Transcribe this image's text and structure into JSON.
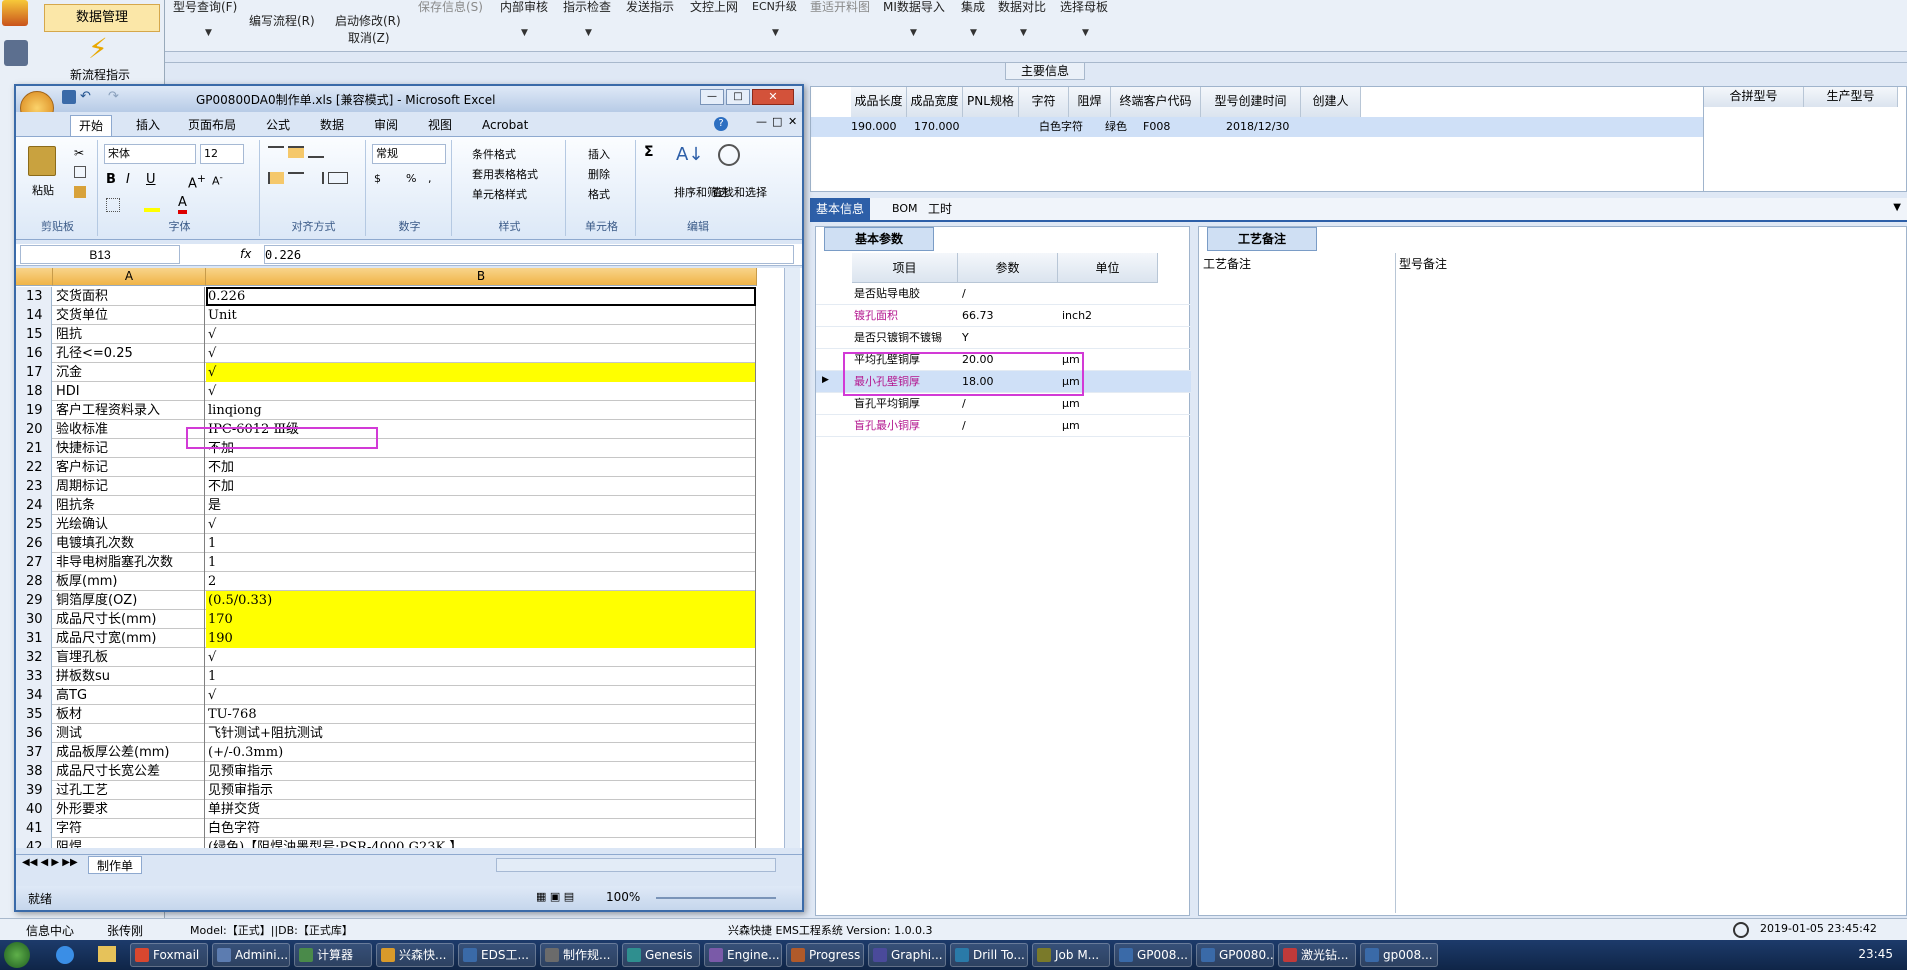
{
  "app": {
    "left_items": [
      "数据管理",
      "新流程指示"
    ],
    "toolbar": [
      {
        "label": "型号查询(F)",
        "disabled": false
      },
      {
        "label": "编写流程(R)",
        "disabled": false
      },
      {
        "label": "启动修改(R)",
        "disabled": false
      },
      {
        "label": "取消(Z)",
        "disabled": false
      },
      {
        "label": "保存信息(S)",
        "disabled": true
      },
      {
        "label": "内部审核",
        "disabled": false
      },
      {
        "label": "指示检查",
        "disabled": false
      },
      {
        "label": "发送指示",
        "disabled": false
      },
      {
        "label": "文控上网",
        "disabled": false
      },
      {
        "label": "ECN升级",
        "disabled": false
      },
      {
        "label": "重适开料图",
        "disabled": true
      },
      {
        "label": "MI数据导入",
        "disabled": false
      },
      {
        "label": "集成",
        "disabled": false
      },
      {
        "label": "数据对比",
        "disabled": false
      },
      {
        "label": "选择母板",
        "disabled": false
      }
    ],
    "main_info_label": "主要信息",
    "top_grid": {
      "headers": [
        "成品长度",
        "成品宽度",
        "PNL规格",
        "字符",
        "阻焊",
        "终端客户代码",
        "型号创建时间",
        "创建人"
      ],
      "row": [
        "190.000",
        "170.000",
        "",
        "白色字符",
        "绿色",
        "F008",
        "2018/12/30",
        ""
      ]
    },
    "right_grid_headers": [
      "合拼型号",
      "生产型号"
    ],
    "tabs": [
      "基本信息",
      "BOM",
      "工时"
    ],
    "params": {
      "panel_title": "基本参数",
      "headers": [
        "项目",
        "参数",
        "单位"
      ],
      "rows": [
        {
          "item": "是否贴导电胶",
          "value": "/",
          "unit": "",
          "magenta": false
        },
        {
          "item": "镀孔面积",
          "value": "66.73",
          "unit": "inch2",
          "magenta": true
        },
        {
          "item": "是否只镀铜不镀锡",
          "value": "Y",
          "unit": "",
          "magenta": false
        },
        {
          "item": "平均孔壁铜厚",
          "value": "20.00",
          "unit": "μm",
          "magenta": false
        },
        {
          "item": "最小孔壁铜厚",
          "value": "18.00",
          "unit": "μm",
          "magenta": true
        },
        {
          "item": "盲孔平均铜厚",
          "value": "/",
          "unit": "μm",
          "magenta": false
        },
        {
          "item": "盲孔最小铜厚",
          "value": "/",
          "unit": "μm",
          "magenta": true
        }
      ]
    },
    "notes": {
      "panel_title": "工艺备注",
      "col1": "工艺备注",
      "col2": "型号备注"
    },
    "status": {
      "info_center": "信息中心",
      "user": "张传刚",
      "model": "Model:【正式】||DB:【正式库】",
      "system": "兴森快捷 EMS工程系统 Version: 1.0.0.3",
      "datetime": "2019-01-05 23:45:42"
    }
  },
  "excel": {
    "title": "GP00800DA0制作单.xls [兼容模式] - Microsoft Excel",
    "tabs": [
      "开始",
      "插入",
      "页面布局",
      "公式",
      "数据",
      "审阅",
      "视图",
      "Acrobat"
    ],
    "ribbon": {
      "clipboard": "剪贴板",
      "paste": "粘贴",
      "font": "字体",
      "font_name": "宋体",
      "font_size": "12",
      "alignment": "对齐方式",
      "number": "数字",
      "number_format": "常规",
      "styles": "样式",
      "cond_format": "条件格式",
      "table_format": "套用表格格式",
      "cell_style": "单元格样式",
      "cells": "单元格",
      "insert": "插入",
      "delete": "删除",
      "format": "格式",
      "editing": "编辑",
      "sort": "排序和筛选",
      "find": "查找和选择"
    },
    "name_box": "B13",
    "formula": "0.226",
    "col_headers": [
      "A",
      "B"
    ],
    "rows": [
      {
        "n": "13",
        "a": "交货面积",
        "b": "0.226",
        "yellow": false
      },
      {
        "n": "14",
        "a": "交货单位",
        "b": "Unit",
        "yellow": false
      },
      {
        "n": "15",
        "a": "阻抗",
        "b": "√",
        "yellow": false
      },
      {
        "n": "16",
        "a": "孔径<=0.25",
        "b": "√",
        "yellow": false
      },
      {
        "n": "17",
        "a": "沉金",
        "b": "√",
        "yellow": true
      },
      {
        "n": "18",
        "a": "HDI",
        "b": "√",
        "yellow": false
      },
      {
        "n": "19",
        "a": "客户工程资料录入",
        "b": "linqiong",
        "yellow": false
      },
      {
        "n": "20",
        "a": "验收标准",
        "b": "IPC-6012 Ⅲ级",
        "yellow": false
      },
      {
        "n": "21",
        "a": "快捷标记",
        "b": "不加",
        "yellow": false
      },
      {
        "n": "22",
        "a": "客户标记",
        "b": "不加",
        "yellow": false
      },
      {
        "n": "23",
        "a": "周期标记",
        "b": "不加",
        "yellow": false
      },
      {
        "n": "24",
        "a": "阻抗条",
        "b": "是",
        "yellow": false
      },
      {
        "n": "25",
        "a": "光绘确认",
        "b": "√",
        "yellow": false
      },
      {
        "n": "26",
        "a": "电镀填孔次数",
        "b": "1",
        "yellow": false
      },
      {
        "n": "27",
        "a": "非导电树脂塞孔次数",
        "b": "1",
        "yellow": false
      },
      {
        "n": "28",
        "a": "板厚(mm)",
        "b": "2",
        "yellow": false
      },
      {
        "n": "29",
        "a": "铜箔厚度(OZ)",
        "b": "(0.5/0.33)",
        "yellow": true
      },
      {
        "n": "30",
        "a": "成品尺寸长(mm)",
        "b": "170",
        "yellow": true
      },
      {
        "n": "31",
        "a": "成品尺寸宽(mm)",
        "b": "190",
        "yellow": true
      },
      {
        "n": "32",
        "a": "盲埋孔板",
        "b": "√",
        "yellow": false
      },
      {
        "n": "33",
        "a": "拼板数su",
        "b": "1",
        "yellow": false
      },
      {
        "n": "34",
        "a": "高TG",
        "b": "√",
        "yellow": false
      },
      {
        "n": "35",
        "a": "板材",
        "b": "TU-768",
        "yellow": false
      },
      {
        "n": "36",
        "a": "测试",
        "b": "飞针测试+阻抗测试",
        "yellow": false
      },
      {
        "n": "37",
        "a": "成品板厚公差(mm)",
        "b": "(+/-0.3mm)",
        "yellow": false
      },
      {
        "n": "38",
        "a": "成品尺寸长宽公差",
        "b": "见预审指示",
        "yellow": false
      },
      {
        "n": "39",
        "a": "过孔工艺",
        "b": "见预审指示",
        "yellow": false
      },
      {
        "n": "40",
        "a": "外形要求",
        "b": "单拼交货",
        "yellow": false
      },
      {
        "n": "41",
        "a": "字符",
        "b": "白色字符",
        "yellow": false
      },
      {
        "n": "42",
        "a": "阻焊",
        "b": "(绿色)【阻焊油墨型号:PSR-4000 G23K 】",
        "yellow": false
      }
    ],
    "sheet_tab": "制作单",
    "status_ready": "就绪",
    "zoom": "100%"
  },
  "taskbar": [
    "Foxmail",
    "Admini...",
    "计算器",
    "兴森快...",
    "EDS工...",
    "制作规...",
    "Genesis",
    "Engine...",
    "Progress",
    "Graphi...",
    "Drill To...",
    "Job M...",
    "GP008...",
    "GP0080...",
    "激光钻...",
    "gp008..."
  ],
  "clock": "23:45",
  "colors": {
    "highlight": "#d23ad6",
    "yellow": "#ffff00",
    "tab_active": "#2d5fa8",
    "magenta_text": "#b3168f"
  }
}
